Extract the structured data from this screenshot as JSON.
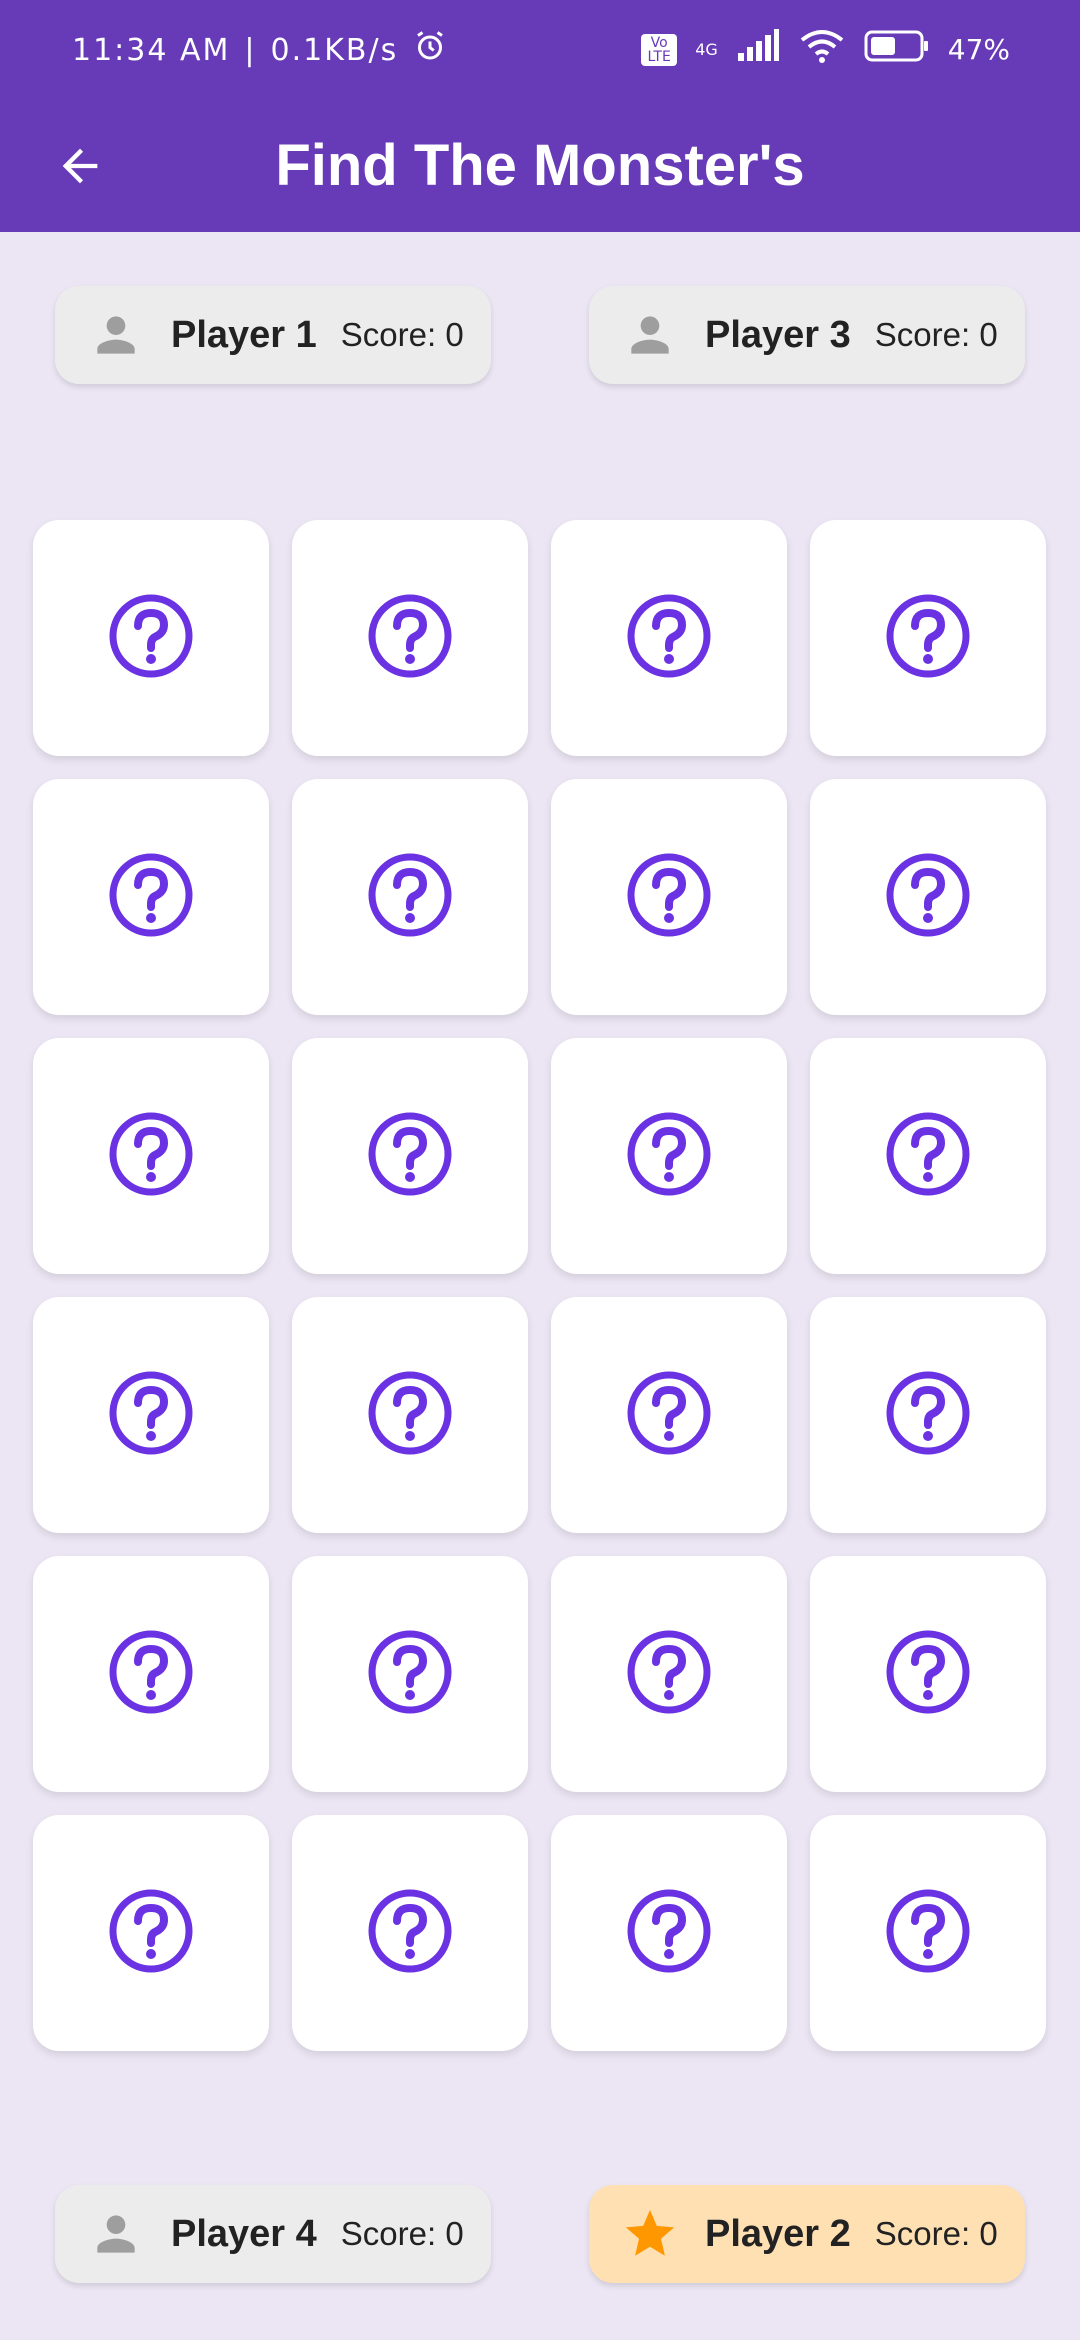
{
  "status_bar": {
    "time": "11:34 AM",
    "net_speed": "0.1KB/s",
    "battery": "47%",
    "network_type": "4G",
    "volte": "Vo LTE"
  },
  "app_bar": {
    "title": "Find The Monster's",
    "back_icon": "arrow-back-icon"
  },
  "players": {
    "p1": {
      "name": "Player 1",
      "score": "Score: 0",
      "icon": "person-icon",
      "active": false
    },
    "p3": {
      "name": "Player 3",
      "score": "Score: 0",
      "icon": "person-icon",
      "active": false
    },
    "p4": {
      "name": "Player 4",
      "score": "Score: 0",
      "icon": "person-icon",
      "active": false
    },
    "p2": {
      "name": "Player 2",
      "score": "Score: 0",
      "icon": "star-icon",
      "active": true
    }
  },
  "board": {
    "rows": 6,
    "columns": 4,
    "tile_icon": "help-circle-icon",
    "tile_state": "hidden"
  },
  "colors": {
    "primary": "#673ab7",
    "background": "#ece6f4",
    "tile_icon": "#6a32e3",
    "active_player": "#ffe0b3",
    "star": "#ff9800"
  }
}
